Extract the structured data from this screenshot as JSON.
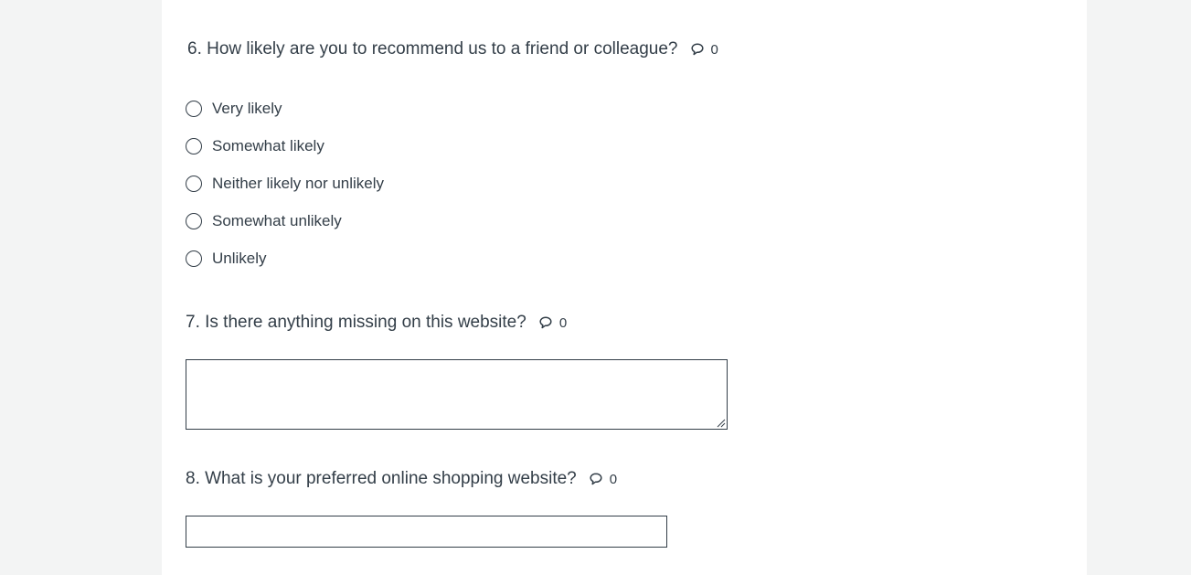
{
  "questions": [
    {
      "title": "6. How likely are you to recommend us to a friend or colleague?",
      "comment_icon": "comment-icon",
      "comment_count": "0",
      "options": [
        {
          "label": "Very likely"
        },
        {
          "label": "Somewhat likely"
        },
        {
          "label": "Neither likely nor unlikely"
        },
        {
          "label": "Somewhat unlikely"
        },
        {
          "label": "Unlikely"
        }
      ]
    },
    {
      "title": "7. Is there anything missing on this website?",
      "comment_icon": "comment-icon",
      "comment_count": "0",
      "answer_value": ""
    },
    {
      "title": "8. What is your preferred online shopping website?",
      "comment_icon": "comment-icon",
      "comment_count": "0",
      "answer_value": ""
    }
  ],
  "colors": {
    "background": "#f3f4f4",
    "panel": "#ffffff",
    "text": "#333e48"
  }
}
